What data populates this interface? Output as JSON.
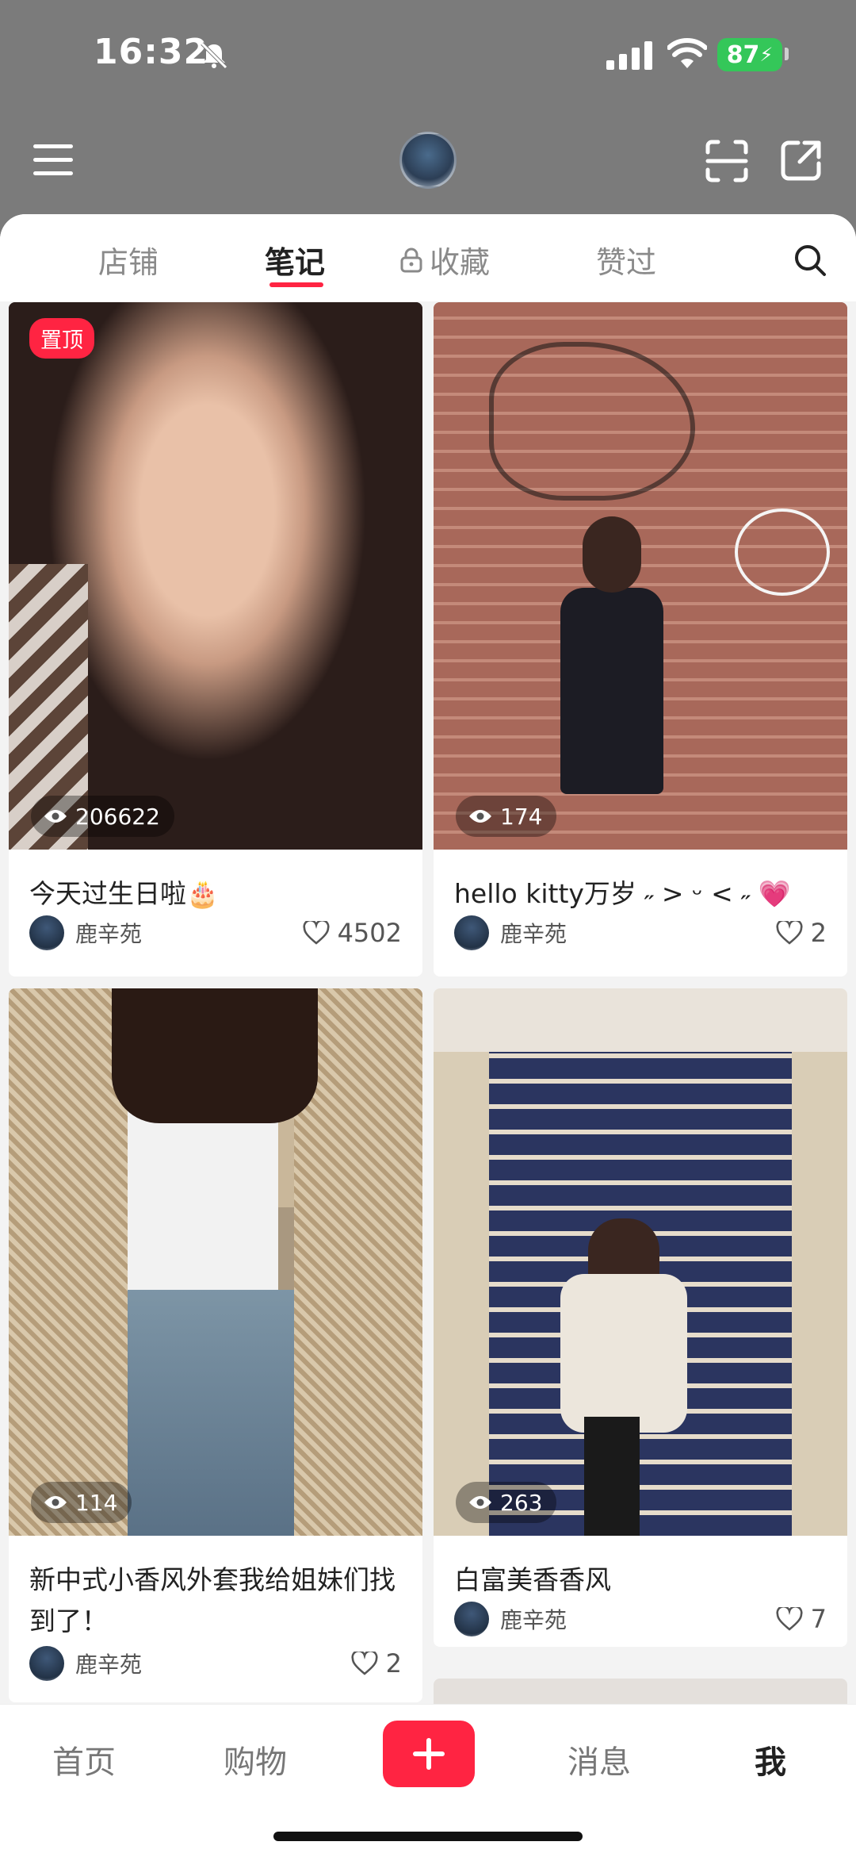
{
  "status_bar": {
    "time": "16:32",
    "battery": "87"
  },
  "tabs": [
    {
      "label": "店铺"
    },
    {
      "label": "笔记"
    },
    {
      "label": "收藏"
    },
    {
      "label": "赞过"
    }
  ],
  "notes": [
    {
      "pinned_label": "置顶",
      "views": "206622",
      "title": "今天过生日啦🎂",
      "author": "鹿辛苑",
      "likes": "4502"
    },
    {
      "views": "174",
      "title": "hello kitty万岁 ˶ > ᵕ < ˶ 💗",
      "author": "鹿辛苑",
      "likes": "2"
    },
    {
      "views": "114",
      "title": "新中式小香风外套我给姐妹们找到了！",
      "author": "鹿辛苑",
      "likes": "2"
    },
    {
      "views": "263",
      "title": "白富美香香风",
      "author": "鹿辛苑",
      "likes": "7"
    }
  ],
  "bottom_nav": [
    {
      "label": "首页"
    },
    {
      "label": "购物"
    },
    {
      "label": "消息"
    },
    {
      "label": "我"
    }
  ],
  "icons": {
    "menu": "menu-icon",
    "scan": "scan-icon",
    "share": "share-icon",
    "search": "search-icon",
    "lock": "lock-icon",
    "add": "plus-icon",
    "views": "eye-icon",
    "likes": "heart-outline-icon"
  },
  "colors": {
    "accent": "#ff2442",
    "header_bg": "#7b7b7b",
    "battery": "#34c759"
  }
}
